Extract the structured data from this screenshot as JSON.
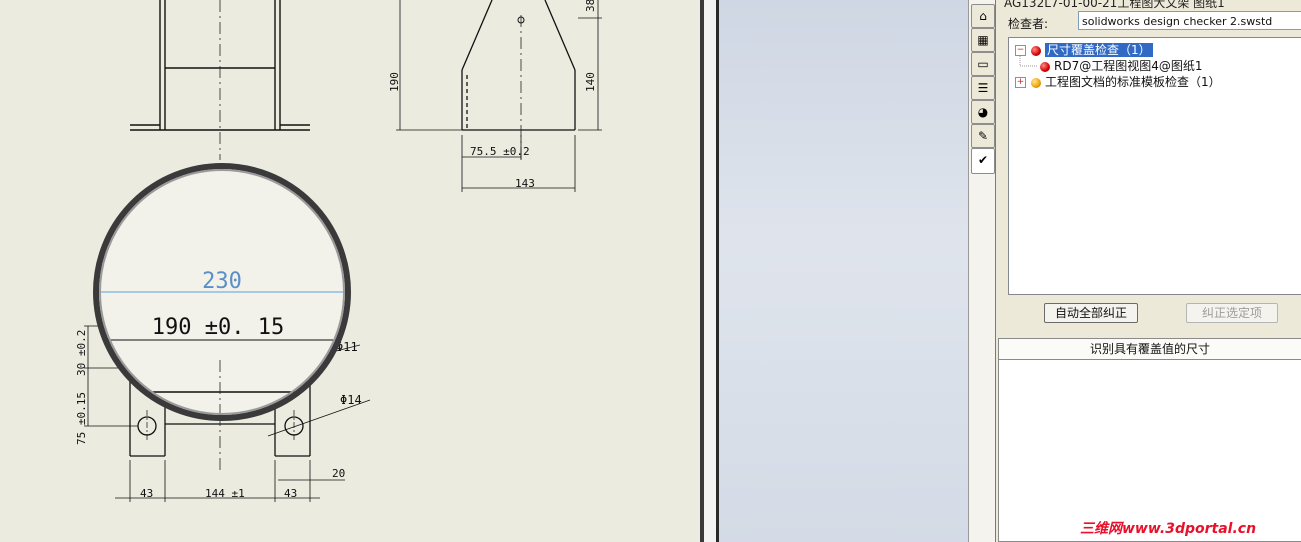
{
  "drawing": {
    "dims": {
      "d190_left": "190",
      "d140": "140",
      "d38": "38",
      "d75_5": "75.5 ±0.2",
      "d143": "143",
      "zoom_230": "230",
      "zoom_190": "190 ±0. 15",
      "d30": "30 ±0.2",
      "d75": "75 ±0.15",
      "phi11": "Φ11",
      "phi14": "Φ14",
      "d43a": "43",
      "d144": "144 ±1",
      "d43b": "43",
      "d20": "20"
    }
  },
  "panel": {
    "title": "AG132L7-01-00-21工程图大文架 图纸1",
    "checker_label": "检查者:",
    "checker_value": "solidworks design checker 2.swstd",
    "tree": [
      {
        "label": "尺寸覆盖检查（1）",
        "status": "red"
      },
      {
        "label": "RD7@工程图视图4@图纸1",
        "status": "red"
      },
      {
        "label": "工程图文档的标准模板检查（1）",
        "status": "yellow"
      }
    ],
    "btn_fix_all": "自动全部纠正",
    "btn_fix_selected": "纠正选定项",
    "section_title": "识别具有覆盖值的尺寸"
  },
  "tabs": [
    "home-icon",
    "chart-icon",
    "folder-icon",
    "properties-icon",
    "appearance-icon",
    "edit-icon",
    "design-checker-icon"
  ],
  "watermark": "三维网www.3dportal.cn"
}
